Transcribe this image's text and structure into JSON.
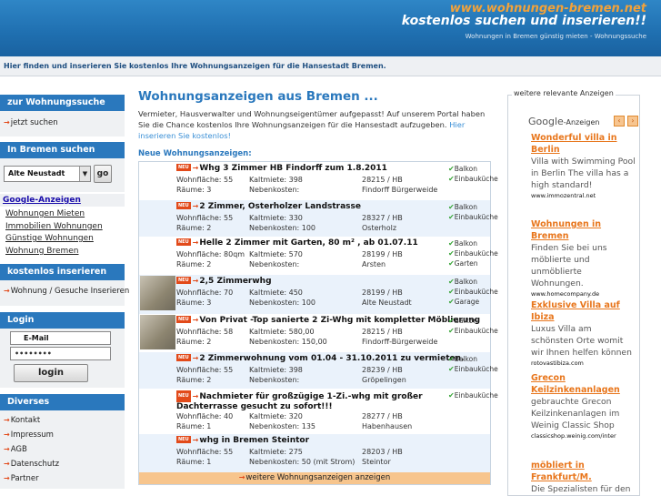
{
  "header": {
    "site_prefix": "www.",
    "site_domain": "wohnungen-bremen",
    "site_suffix": ".net",
    "tagline": "kostenlos suchen und inserieren!!",
    "subtitle": "Wohnungen in Bremen günstig mieten - Wohnungssuche"
  },
  "intro_bar": "Hier finden und inserieren Sie kostenlos Ihre Wohnungsanzeigen für die Hansestadt Bremen.",
  "sidebar": {
    "search_head": "zur Wohnungssuche",
    "search_link": "jetzt suchen",
    "bremen_head": "In Bremen suchen",
    "district_value": "Alte Neustadt",
    "go_label": "go",
    "google_head": "Google-Anzeigen",
    "google_links": [
      "Wohnungen Mieten",
      "Immobilien Wohnungen",
      "Günstige Wohnungen",
      "Wohnung Bremen"
    ],
    "insert_head": "kostenlos inserieren",
    "insert_link": "Wohnung / Gesuche  Inserieren",
    "login_head": "Login",
    "email_value": "E-Mail",
    "password_value": "••••••••",
    "login_label": "login",
    "misc_head": "Diverses",
    "misc_links": [
      "Kontakt",
      "Impressum",
      "AGB",
      "Datenschutz",
      "Partner"
    ]
  },
  "main": {
    "title": "Wohnungsanzeigen aus Bremen ...",
    "intro": "Vermieter, Hausverwalter und Wohnungseigentümer aufgepasst! Auf unserem Portal haben Sie die Chance kostenlos Ihre Wohnungsanzeigen für die Hansestadt aufzugeben.",
    "intro_link": "Hier inserieren Sie kostenlos!",
    "new_label": "Neue Wohnungsanzeigen:",
    "badge": "NEU",
    "more": "weitere Wohnungsanzeigen anzeigen"
  },
  "listings": [
    {
      "title": "Whg 3 Zimmer HB Findorff zum 1.8.2011",
      "flaeche": "Wohnfläche: 55",
      "raeume": "Räume: 3",
      "kalt": "Kaltmiete: 398",
      "neben": "Nebenkosten:",
      "plz": "28215 / HB",
      "ort": "Findorff Bürgerweide",
      "feats": [
        "Balkon",
        "Einbauküche"
      ],
      "thumb": false
    },
    {
      "title": "2 Zimmer, Osterholzer Landstrasse",
      "flaeche": "Wohnfläche: 55",
      "raeume": "Räume: 2",
      "kalt": "Kaltmiete: 330",
      "neben": "Nebenkosten: 100",
      "plz": "28327 / HB",
      "ort": "Osterholz",
      "feats": [
        "Balkon",
        "Einbauküche"
      ],
      "thumb": false
    },
    {
      "title": "Helle 2 Zimmer mit Garten, 80 m² , ab 01.07.11",
      "flaeche": "Wohnfläche: 80qm",
      "raeume": "Räume: 2",
      "kalt": "Kaltmiete: 570",
      "neben": "Nebenkosten:",
      "plz": "28199 / HB",
      "ort": "Arsten",
      "feats": [
        "Balkon",
        "Einbauküche",
        "Garten"
      ],
      "thumb": false
    },
    {
      "title": "2,5 Zimmerwhg",
      "flaeche": "Wohnfläche: 70",
      "raeume": "Räume: 3",
      "kalt": "Kaltmiete: 450",
      "neben": "Nebenkosten: 100",
      "plz": "28199 / HB",
      "ort": "Alte Neustadt",
      "feats": [
        "Balkon",
        "Einbauküche",
        "Garage"
      ],
      "thumb": true
    },
    {
      "title": "Von Privat -Top sanierte 2 Zi-Whg mit kompletter Möblierung",
      "flaeche": "Wohnfläche: 58",
      "raeume": "Räume: 2",
      "kalt": "Kaltmiete: 580,00",
      "neben": "Nebenkosten: 150,00",
      "plz": "28215 / HB",
      "ort": "Findorff-Bürgerweide",
      "feats": [
        "Balkon",
        "Einbauküche"
      ],
      "thumb": true
    },
    {
      "title": "2 Zimmerwohnung vom 01.04 - 31.10.2011 zu vermieten.",
      "flaeche": "Wohnfläche: 55",
      "raeume": "Räume: 2",
      "kalt": "Kaltmiete: 398",
      "neben": "Nebenkosten:",
      "plz": "28239 / HB",
      "ort": "Gröpelingen",
      "feats": [
        "Balkon",
        "Einbauküche"
      ],
      "thumb": false
    },
    {
      "title": "Nachmieter für großzügige 1-Zi.-whg mit großer Dachterrasse gesucht zu sofort!!!",
      "flaeche": "Wohnfläche: 40",
      "raeume": "Räume: 1",
      "kalt": "Kaltmiete: 320",
      "neben": "Nebenkosten: 135",
      "plz": "28277 / HB",
      "ort": "Habenhausen",
      "feats": [
        "Einbauküche"
      ],
      "thumb": false
    },
    {
      "title": "whg in Bremen Steintor",
      "flaeche": "Wohnfläche: 55",
      "raeume": "Räume: 1",
      "kalt": "Kaltmiete: 275",
      "neben": "Nebenkosten: 50 (mit Strom)",
      "plz": "28203 / HB",
      "ort": "Steintor",
      "feats": [],
      "thumb": false
    }
  ],
  "ads": {
    "title": "weitere relevante Anzeigen",
    "google_word": "Google",
    "google_suffix": "-Anzeigen",
    "items": [
      {
        "head": "Wonderful villa in Berlin",
        "text": "Villa with Swimming Pool in Berlin The villa has a high standard!",
        "url": "www.immozentral.net"
      },
      {
        "head": "Wohnungen in Bremen",
        "text": "Finden Sie bei uns möblierte und unmöblierte Wohnungen.",
        "url": "www.homecompany.de"
      },
      {
        "head": "Exklusive Villa auf Ibiza",
        "text": "Luxus Villa am schönsten Orte womit wir Ihnen helfen können",
        "url": "rotovastibiza.com"
      },
      {
        "head": "Grecon Keilzinkenanlagen",
        "text": "gebrauchte Grecon Keilzinkenanlagen im Weinig Classic Shop",
        "url": "classicshop.weinig.com/inter"
      },
      {
        "head": "möbliert in Frankfurt/M.",
        "text": "Die Spezialisten für den möblierten Wohnraum in",
        "url": ""
      }
    ]
  }
}
